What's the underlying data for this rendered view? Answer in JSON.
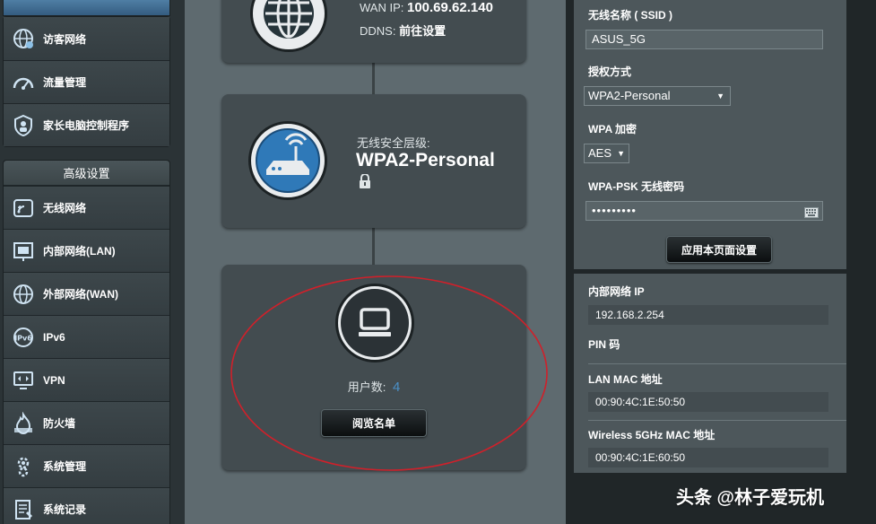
{
  "sidebar": {
    "top_items": [
      {
        "label": "访客网络",
        "icon": "guest-network-icon"
      },
      {
        "label": "流量管理",
        "icon": "traffic-manager-icon"
      },
      {
        "label": "家长电脑控制程序",
        "icon": "parental-control-icon"
      }
    ],
    "advanced_header": "高级设置",
    "advanced_items": [
      {
        "label": "无线网络",
        "icon": "wireless-icon"
      },
      {
        "label": "内部网络(LAN)",
        "icon": "lan-icon"
      },
      {
        "label": "外部网络(WAN)",
        "icon": "wan-icon"
      },
      {
        "label": "IPv6",
        "icon": "ipv6-icon"
      },
      {
        "label": "VPN",
        "icon": "vpn-icon"
      },
      {
        "label": "防火墙",
        "icon": "firewall-icon"
      },
      {
        "label": "系统管理",
        "icon": "administration-icon"
      },
      {
        "label": "系统记录",
        "icon": "system-log-icon"
      }
    ]
  },
  "internet_card": {
    "wan_ip_label": "WAN IP:",
    "wan_ip": "100.69.62.140",
    "ddns_label": "DDNS:",
    "ddns_link": "前往设置"
  },
  "security_card": {
    "label": "无线安全层级:",
    "value": "WPA2-Personal"
  },
  "clients_card": {
    "label": "用户数:",
    "count": "4",
    "button": "阅览名单"
  },
  "wireless": {
    "ssid_label": "无线名称 ( SSID )",
    "ssid_value": "ASUS_5G",
    "auth_label": "授权方式",
    "auth_value": "WPA2-Personal",
    "enc_label": "WPA 加密",
    "enc_value": "AES",
    "psk_label": "WPA-PSK 无线密码",
    "psk_value": "•••••••••",
    "apply_button": "应用本页面设置"
  },
  "lan_info": {
    "ip_label": "内部网络 IP",
    "ip_value": "192.168.2.254",
    "pin_label": "PIN 码",
    "mac_label": "LAN MAC 地址",
    "mac_value": "00:90:4C:1E:50:50",
    "wmac_label": "Wireless 5GHz MAC 地址",
    "wmac_value": "00:90:4C:1E:60:50"
  },
  "watermark": "头条 @林子爱玩机",
  "colors": {
    "accent": "#4a90c8",
    "annotation": "#d0202a"
  }
}
